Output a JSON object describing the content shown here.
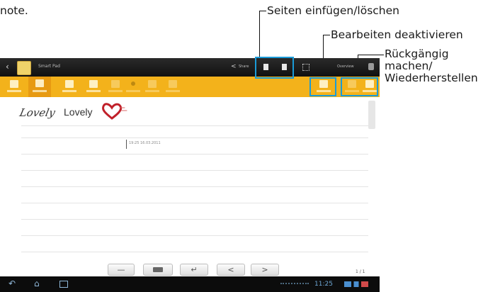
{
  "doc_fragment": "note.",
  "callouts": {
    "insert_delete": "Seiten einfügen/löschen",
    "disable_editing": "Bearbeiten deaktivieren",
    "undo_redo_line1": "Rückgängig",
    "undo_redo_line2": "machen/",
    "undo_redo_line3": "Wiederherstellen"
  },
  "app": {
    "title": "Smart Pad",
    "share_label": "Share",
    "menu_label": "Overview"
  },
  "note": {
    "handwriting": "Lovely",
    "typed_word": "Lovely",
    "timestamp": "19:25 16.03.2011"
  },
  "bottom_bar": {
    "page_indicator": "1 / 1",
    "btn_lt": "<",
    "btn_gt": ">",
    "clock": "11:25"
  },
  "colors": {
    "toolbar": "#f3b21b",
    "topbar": "#1c1c1c",
    "callout_box": "#1a9bd8"
  }
}
